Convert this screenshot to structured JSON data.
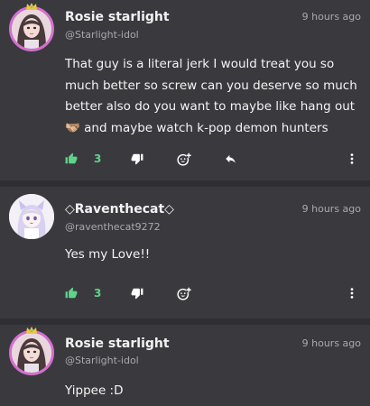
{
  "posts": [
    {
      "username": "Rosie starlight",
      "handle": "@Starlight-idol",
      "time": "9 hours ago",
      "body_line1": "That guy is a literal jerk I would treat you so",
      "body_line2": "much better so screw can you deserve so much",
      "body_line3": "better also do you want to maybe like hang out",
      "body_line4_emoji": "🫱🏼‍🫲🏽",
      "body_line4": "and maybe watch k-pop demon hunters",
      "likes": "3",
      "avatar": "rosie"
    },
    {
      "username": "◇Raventhecat◇",
      "handle": "@raventhecat9272",
      "time": "9 hours ago",
      "body": "Yes my Love!!",
      "likes": "3",
      "avatar": "raven"
    },
    {
      "username": "Rosie starlight",
      "handle": "@Starlight-idol",
      "time": "9 hours ago",
      "body": "Yippee :D",
      "avatar": "rosie"
    }
  ],
  "icons": {
    "like": "thumbs-up-icon",
    "dislike": "thumbs-down-icon",
    "react": "add-reaction-icon",
    "reply": "reply-icon",
    "more": "more-vertical-icon"
  },
  "colors": {
    "like_count": "#5fd38a",
    "avatar_border": "#d46fd0",
    "background": "#3a3a3e"
  }
}
